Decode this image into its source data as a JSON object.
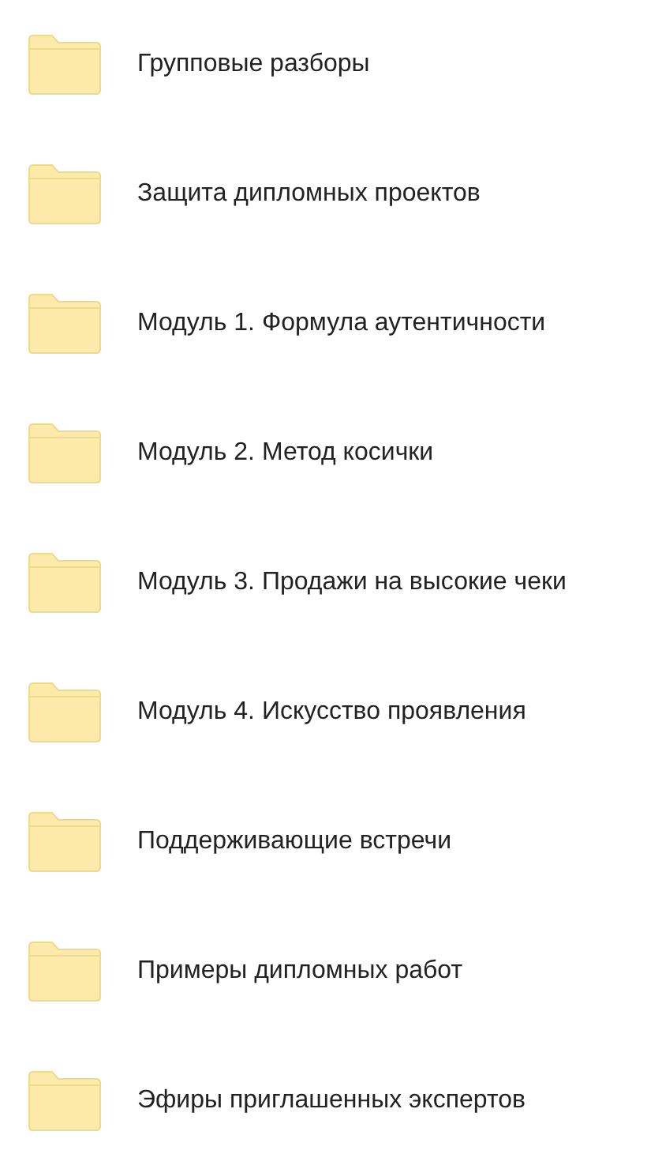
{
  "folders": [
    {
      "name": "Групповые разборы"
    },
    {
      "name": "Защита дипломных проектов"
    },
    {
      "name": "Модуль 1. Формула аутентичности"
    },
    {
      "name": "Модуль 2. Метод косички"
    },
    {
      "name": "Модуль 3. Продажи на высокие чеки"
    },
    {
      "name": "Модуль 4. Искусство проявления"
    },
    {
      "name": "Поддерживающие встречи"
    },
    {
      "name": "Примеры дипломных работ"
    },
    {
      "name": "Эфиры приглашенных экспертов"
    }
  ]
}
